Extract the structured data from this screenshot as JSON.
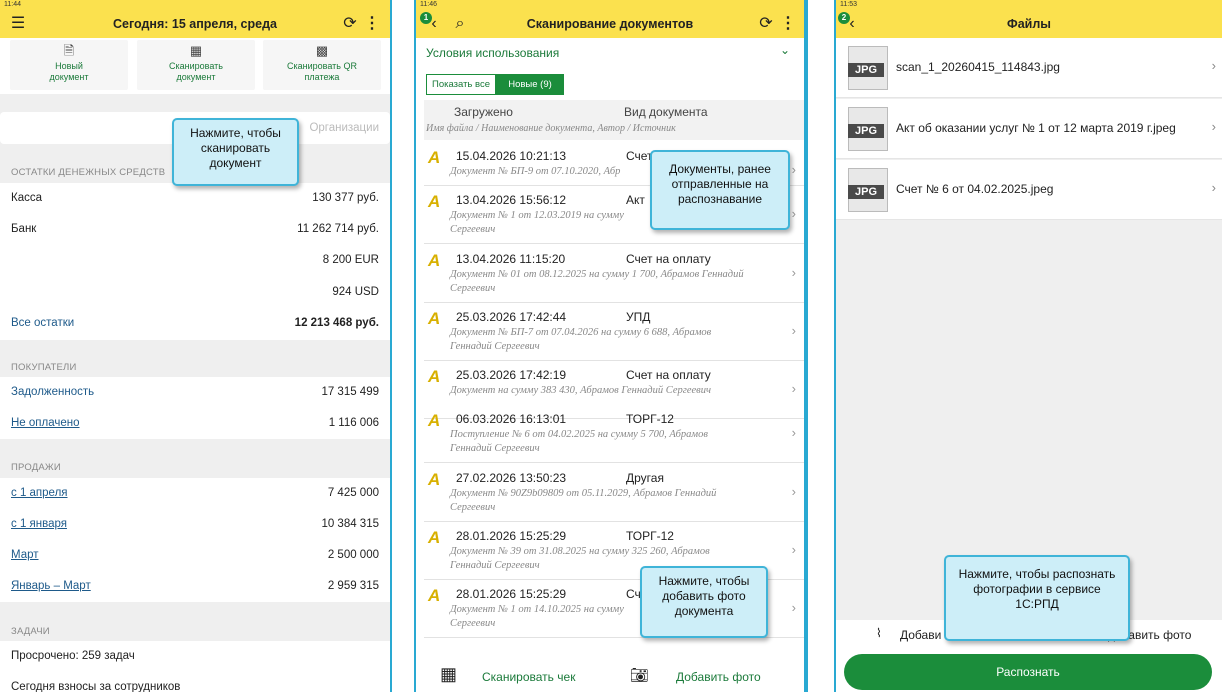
{
  "p1": {
    "status_time": "11:44",
    "title": "Сегодня: 15 апреля, среда",
    "tiles": [
      {
        "l1": "Новый",
        "l2": "документ"
      },
      {
        "l1": "Сканировать",
        "l2": "документ"
      },
      {
        "l1": "Сканировать QR",
        "l2": "платежа"
      }
    ],
    "org_placeholder": "Организации",
    "callout": {
      "l1": "Нажмите, чтобы",
      "l2": "сканировать",
      "l3": "документ"
    },
    "cash": {
      "section": "ОСТАТКИ ДЕНЕЖНЫХ СРЕДСТВ",
      "kassa": "Касса",
      "kassa_v": "130 377 руб.",
      "bank": "Банк",
      "bank_v": "11 262 714 руб.",
      "eur": "8 200 EUR",
      "usd": "924 USD",
      "all": "Все остатки",
      "all_v": "12 213 468 руб."
    },
    "buyers": {
      "section": "ПОКУПАТЕЛИ",
      "debt": "Задолженность",
      "debt_v": "17 315 499",
      "unpaid": "Не оплачено",
      "unpaid_v": "1 116 006"
    },
    "sales": {
      "section": "ПРОДАЖИ",
      "r1": "с 1 апреля",
      "r1_v": "7 425 000",
      "r2": "с 1 января",
      "r2_v": "10 384 315",
      "r3": "Март",
      "r3_v": "2 500 000",
      "r4": "Январь – Март",
      "r4_v": "2 959 315"
    },
    "tasks": {
      "section": "ЗАДАЧИ",
      "overdue": "Просрочено: 259 задач",
      "today": "Сегодня взносы за сотрудников"
    }
  },
  "p2": {
    "status_time": "11:46",
    "title": "Сканирование документов",
    "terms": "Условия использования",
    "show_all": "Показать все",
    "new": "Новые (9)",
    "col_loaded": "Загружено",
    "col_kind": "Вид документа",
    "subhead": "Имя файла / Наименование документа, Автор / Источник",
    "docs": [
      {
        "date": "15.04.2026 10:21:13",
        "kind": "Счет",
        "d1": "Документ № БП-9 от 07.10.2020, Абр",
        "d2": ""
      },
      {
        "date": "13.04.2026 15:56:12",
        "kind": "Акт",
        "d1": "Документ № 1 от 12.03.2019 на сумму",
        "d2": "Сергеевич"
      },
      {
        "date": "13.04.2026 11:15:20",
        "kind": "Счет на оплату",
        "d1": "Документ № 01 от 08.12.2025 на сумму 1 700, Абрамов Геннадий",
        "d2": "Сергеевич"
      },
      {
        "date": "25.03.2026 17:42:44",
        "kind": "УПД",
        "d1": "Документ № БП-7 от 07.04.2026 на сумму 6 688, Абрамов",
        "d2": "Геннадий Сергеевич"
      },
      {
        "date": "25.03.2026 17:42:19",
        "kind": "Счет на оплату",
        "d1": "Документ на сумму 383 430, Абрамов Геннадий Сергеевич",
        "d2": ""
      },
      {
        "date": "06.03.2026 16:13:01",
        "kind": "ТОРГ-12",
        "d1": "Поступление № 6 от 04.02.2025 на сумму 5 700, Абрамов",
        "d2": "Геннадий Сергеевич"
      },
      {
        "date": "27.02.2026 13:50:23",
        "kind": "Другая",
        "d1": "Документ № 90Z9b09809 от 05.11.2029, Абрамов Геннадий",
        "d2": "Сергеевич"
      },
      {
        "date": "28.01.2026 15:25:29",
        "kind": "ТОРГ-12",
        "d1": "Документ № 39 от 31.08.2025 на сумму 325 260, Абрамов",
        "d2": "Геннадий Сергеевич"
      },
      {
        "date": "28.01.2026 15:25:29",
        "kind": "Сче",
        "d1": "Документ № 1 от 14.10.2025 на сумму",
        "d2": "Сергеевич"
      }
    ],
    "callout_docs": {
      "l1": "Документы, ранее",
      "l2": "отправленные на",
      "l3": "распознавание"
    },
    "callout_photo": {
      "l1": "Нажмите, чтобы",
      "l2": "добавить фото",
      "l3": "документа"
    },
    "scan_receipt": "Сканировать чек",
    "add_photo": "Добавить фото"
  },
  "p3": {
    "status_time": "11:53",
    "title": "Файлы",
    "jpg": "JPG",
    "files": [
      "scan_1_20260415_114843.jpg",
      "Акт об оказании услуг № 1 от 12 марта 2019 г.jpeg",
      "Счет № 6 от 04.02.2025.jpeg"
    ],
    "attach": "Добави",
    "add_photo": "добавить фото",
    "callout": {
      "l1": "Нажмите, чтобы распознать",
      "l2": "фотографии в сервисе",
      "l3": "1С:РПД"
    },
    "recognize": "Распознать"
  },
  "colors": {
    "header": "#fbe14e",
    "accent": "#1b8d3b",
    "callout_border": "#3fb4d8",
    "callout_bg": "#cdeef8"
  }
}
